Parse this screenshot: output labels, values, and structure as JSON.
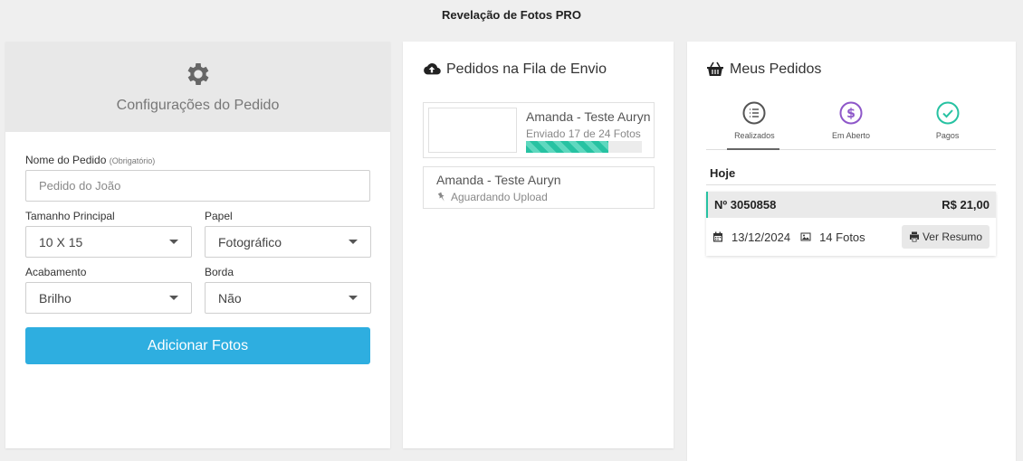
{
  "app": {
    "title": "Revelação de Fotos PRO"
  },
  "config": {
    "title": "Configurações do Pedido",
    "order_name": {
      "label": "Nome do Pedido",
      "hint": "(Obrigatório)",
      "placeholder": "Pedido do João",
      "value": ""
    },
    "main_size": {
      "label": "Tamanho Principal",
      "value": "10 X 15"
    },
    "paper": {
      "label": "Papel",
      "value": "Fotográfico"
    },
    "finish": {
      "label": "Acabamento",
      "value": "Brilho"
    },
    "border": {
      "label": "Borda",
      "value": "Não"
    },
    "add_button": "Adicionar Fotos"
  },
  "queue": {
    "title": "Pedidos na Fila de Envio",
    "items": [
      {
        "name": "Amanda - Teste Auryn",
        "status": "Enviado 17 de 24 Fotos",
        "progress": 0.708
      },
      {
        "name": "Amanda - Teste Auryn",
        "status": "Aguardando Upload"
      }
    ]
  },
  "orders": {
    "title": "Meus Pedidos",
    "tabs": [
      {
        "label": "Realizados",
        "icon": "list-icon",
        "color": "#555555",
        "active": true
      },
      {
        "label": "Em Aberto",
        "icon": "dollar-icon",
        "color": "#8e57c9",
        "active": false
      },
      {
        "label": "Pagos",
        "icon": "check-icon",
        "color": "#27c2a2",
        "active": false
      }
    ],
    "section": "Hoje",
    "items": [
      {
        "number": "Nº 3050858",
        "total": "R$ 21,00",
        "date": "13/12/2024",
        "photos": "14 Fotos",
        "button": "Ver Resumo"
      }
    ]
  },
  "colors": {
    "accent": "#2eaee0",
    "success": "#27c2a2",
    "purple": "#8e57c9"
  }
}
